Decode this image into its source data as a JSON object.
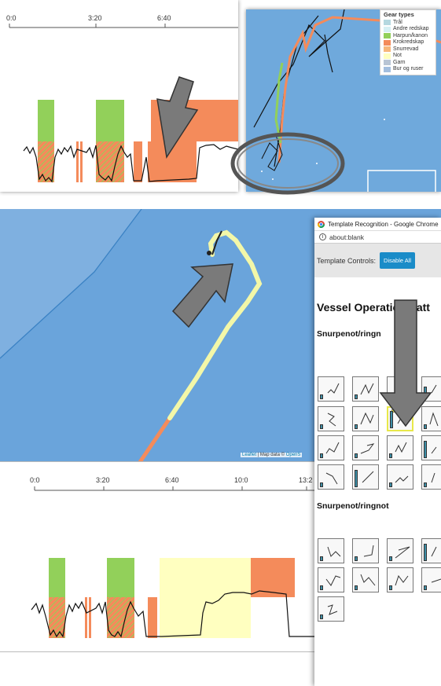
{
  "timeline": {
    "ticks_top": [
      "0:0",
      "3:20",
      "6:40"
    ],
    "ticks_bottom": [
      "0:0",
      "3:20",
      "6:40",
      "10:0",
      "13:2"
    ]
  },
  "legend": {
    "title": "Gear types",
    "items": [
      {
        "label": "Trål",
        "color": "#b5d8e0"
      },
      {
        "label": "Andre redskap",
        "color": "#d6f0f4"
      },
      {
        "label": "Harpun/kanon",
        "color": "#92d05a"
      },
      {
        "label": "Krokredskap",
        "color": "#f48b5b"
      },
      {
        "label": "Snurrevad",
        "color": "#f7b67a"
      },
      {
        "label": "Not",
        "color": "#ffffc0"
      },
      {
        "label": "Garn",
        "color": "#b8c4d4"
      },
      {
        "label": "Bur og ruser",
        "color": "#a3bede"
      }
    ]
  },
  "map": {
    "attribution_link": "Leaflet",
    "attribution_text": " | Map data © ",
    "attribution_link2": "OpenS"
  },
  "window": {
    "title": "Template Recognition - Google Chrome",
    "url": "about:blank",
    "controls_label": "Template Controls:",
    "disable_button": "Disable All",
    "page_heading": "Vessel Operation Patt",
    "section_1": "Snurpenot/ringn",
    "section_2": "Snurpenot/ringnot"
  },
  "colors": {
    "green": "#92d05a",
    "orange": "#f48b5b",
    "yellow": "#ffffc0",
    "sea": "#6fa9dc",
    "track_highlight": "#f3f7a8",
    "arrow_gray": "#7a7a7a"
  }
}
